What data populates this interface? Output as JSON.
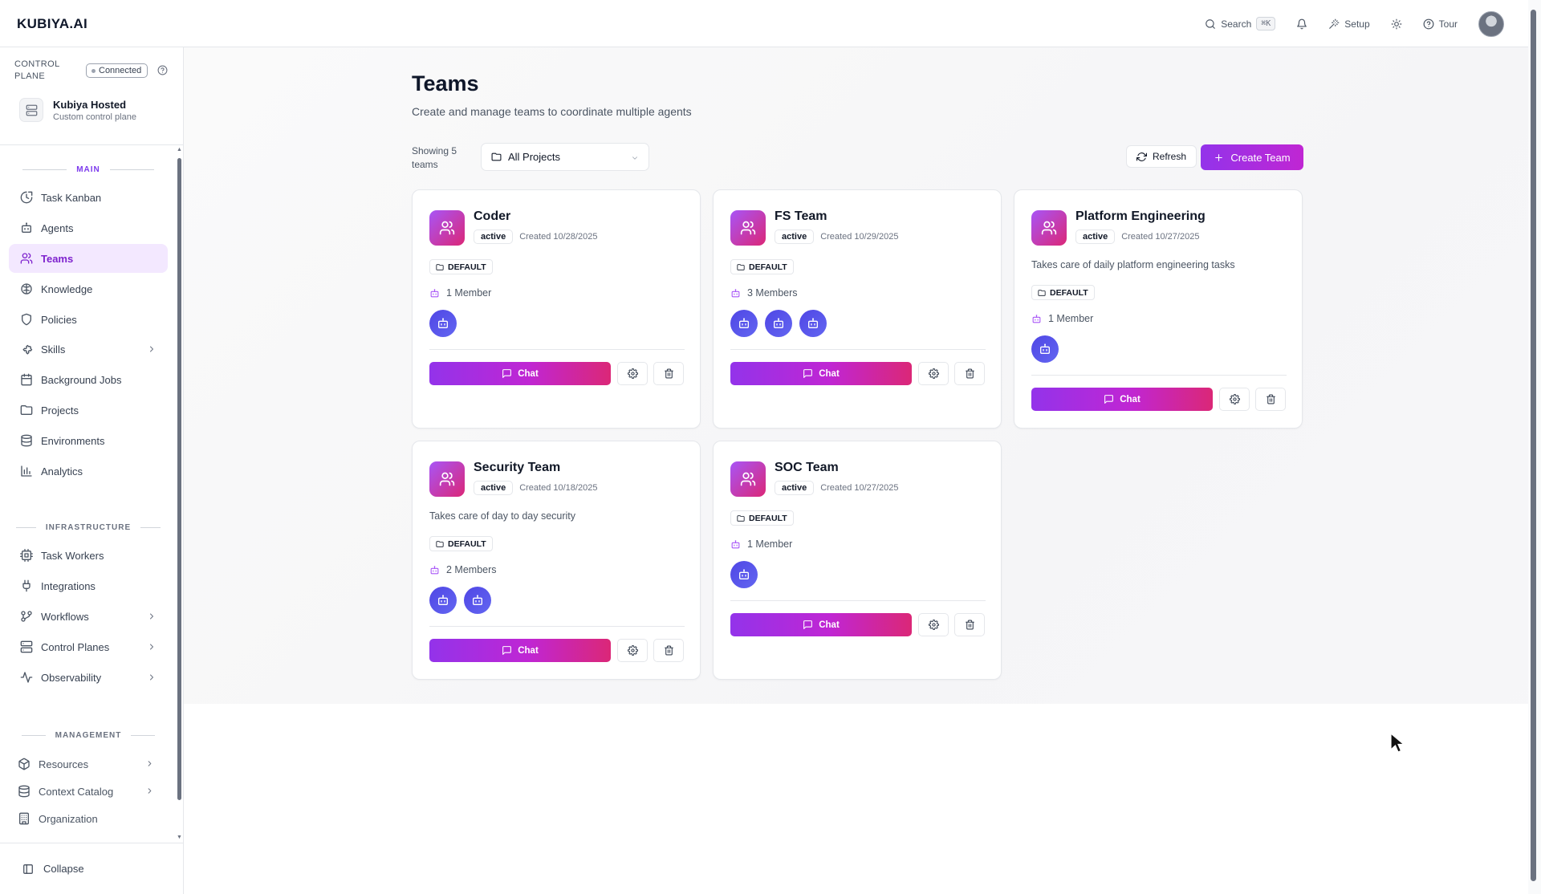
{
  "app": {
    "logo": "KUBIYA.AI"
  },
  "topbar": {
    "search_label": "Search",
    "search_shortcut": "⌘K",
    "setup_label": "Setup",
    "tour_label": "Tour"
  },
  "control_plane": {
    "label": "CONTROL PLANE",
    "status": "Connected",
    "host_name": "Kubiya Hosted",
    "host_sub": "Custom control plane"
  },
  "sidebar": {
    "sections": {
      "main": "MAIN",
      "infrastructure": "INFRASTRUCTURE",
      "management": "MANAGEMENT"
    },
    "main_items": [
      {
        "label": "Task Kanban",
        "icon": "kanban-icon"
      },
      {
        "label": "Agents",
        "icon": "bot-icon"
      },
      {
        "label": "Teams",
        "icon": "users-icon",
        "active": true
      },
      {
        "label": "Knowledge",
        "icon": "brain-icon"
      },
      {
        "label": "Policies",
        "icon": "shield-icon"
      },
      {
        "label": "Skills",
        "icon": "puzzle-icon"
      },
      {
        "label": "Background Jobs",
        "icon": "calendar-icon"
      },
      {
        "label": "Projects",
        "icon": "folder-icon"
      },
      {
        "label": "Environments",
        "icon": "database-icon"
      },
      {
        "label": "Analytics",
        "icon": "bar-chart-icon"
      }
    ],
    "infra_items": [
      {
        "label": "Task Workers",
        "icon": "cpu-icon"
      },
      {
        "label": "Integrations",
        "icon": "plug-icon"
      },
      {
        "label": "Workflows",
        "icon": "workflow-icon"
      },
      {
        "label": "Control Planes",
        "icon": "server-icon"
      },
      {
        "label": "Observability",
        "icon": "activity-icon"
      }
    ],
    "mgmt_items": [
      {
        "label": "Resources",
        "icon": "box-icon"
      },
      {
        "label": "Context Catalog",
        "icon": "database-icon"
      },
      {
        "label": "Organization",
        "icon": "building-icon"
      }
    ],
    "collapse_label": "Collapse"
  },
  "page": {
    "title": "Teams",
    "subtitle": "Create and manage teams to coordinate multiple agents",
    "showing": "Showing 5 teams",
    "project_filter": "All Projects",
    "refresh_label": "Refresh",
    "create_label": "Create Team"
  },
  "teams": [
    {
      "name": "Coder",
      "status": "active",
      "created": "Created 10/28/2025",
      "description": "",
      "project": "DEFAULT",
      "members": "1 Member",
      "agent_count": 1,
      "chat_label": "Chat"
    },
    {
      "name": "FS Team",
      "status": "active",
      "created": "Created 10/29/2025",
      "description": "",
      "project": "DEFAULT",
      "members": "3 Members",
      "agent_count": 3,
      "chat_label": "Chat"
    },
    {
      "name": "Platform Engineering",
      "status": "active",
      "created": "Created 10/27/2025",
      "description": "Takes care of daily platform engineering tasks",
      "project": "DEFAULT",
      "members": "1 Member",
      "agent_count": 1,
      "chat_label": "Chat"
    },
    {
      "name": "Security Team",
      "status": "active",
      "created": "Created 10/18/2025",
      "description": "Takes care of day to day security",
      "project": "DEFAULT",
      "members": "2 Members",
      "agent_count": 2,
      "chat_label": "Chat"
    },
    {
      "name": "SOC Team",
      "status": "active",
      "created": "Created 10/27/2025",
      "description": "",
      "project": "DEFAULT",
      "members": "1 Member",
      "agent_count": 1,
      "chat_label": "Chat"
    }
  ],
  "colors": {
    "accent": "#9333ea",
    "accent_pink": "#db2777",
    "agent_avatar": "#4f46e5",
    "active_nav_bg": "#f3e8ff"
  }
}
